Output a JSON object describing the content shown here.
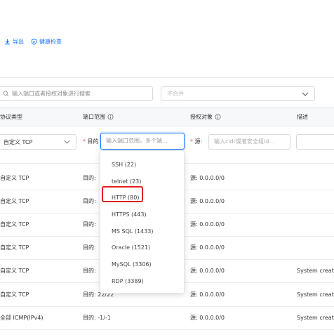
{
  "toolbar": {
    "export_label": "导出",
    "health_label": "健康检查"
  },
  "filter": {
    "search_placeholder": "输入端口或者授权对象进行搜索",
    "select_value": "不合并"
  },
  "table": {
    "headers": {
      "protocol": "协议类型",
      "port": "端口范围",
      "auth": "授权对象",
      "desc": "描述"
    },
    "edit_row": {
      "protocol": "自定义 TCP",
      "port_prefix": "目的",
      "port_placeholder": "输入端口范围，多个端...",
      "source_prefix": "源",
      "cidr_placeholder": "输入cidr或者安全组id..."
    },
    "rows": [
      {
        "protocol": "自定义 TCP",
        "port": "目的:",
        "auth": "源: 0.0.0.0/0",
        "desc": ""
      },
      {
        "protocol": "自定义 TCP",
        "port": "目的:",
        "auth": "源: 0.0.0.0/0",
        "desc": ""
      },
      {
        "protocol": "自定义 TCP",
        "port": "目的:",
        "auth": "源: 0.0.0.0/0",
        "desc": ""
      },
      {
        "protocol": "自定义 TCP",
        "port": "目的:",
        "auth": "源: 0.0.0.0/0",
        "desc": ""
      },
      {
        "protocol": "自定义 TCP",
        "port": "目的:",
        "auth": "源: 0.0.0.0/0",
        "desc": "System create"
      },
      {
        "protocol": "自定义 TCP",
        "port": "目的: 22/22",
        "auth": "源: 0.0.0.0/0",
        "desc": "System create"
      },
      {
        "protocol": "全部 ICMP(IPv4)",
        "port": "目的: -1/-1",
        "auth": "源: 0.0.0.0/0",
        "desc": "System create"
      }
    ]
  },
  "dropdown": {
    "items": [
      "SSH (22)",
      "telnet (23)",
      "HTTP (80)",
      "HTTPS (443)",
      "MS SQL (1433)",
      "Oracle (1521)",
      "MySQL (3306)",
      "RDP (3389)"
    ],
    "highlighted": "HTTP (80)"
  },
  "colors": {
    "accent": "#1677ff",
    "highlight_border": "#e02020",
    "required": "#ff4d4f"
  }
}
